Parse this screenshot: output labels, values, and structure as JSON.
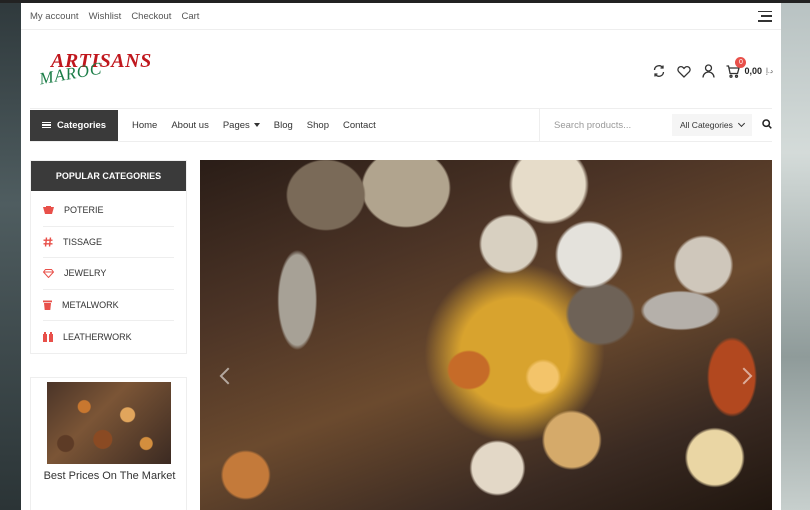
{
  "topbar": {
    "links": [
      "My account",
      "Wishlist",
      "Checkout",
      "Cart"
    ]
  },
  "logo": {
    "line1": "ARTISANS",
    "line2": "MAROC"
  },
  "cart": {
    "count": "0",
    "total": "0,00",
    "currency": "د.إ"
  },
  "nav": {
    "categories_label": "Categories",
    "menu": [
      "Home",
      "About us",
      "Pages",
      "Blog",
      "Shop",
      "Contact"
    ],
    "search_placeholder": "Search products...",
    "category_select": "All Categories"
  },
  "sidebar": {
    "heading": "POPULAR CATEGORIES",
    "items": [
      {
        "label": "POTERIE",
        "icon": "pottery-icon"
      },
      {
        "label": "TISSAGE",
        "icon": "hash-icon"
      },
      {
        "label": "JEWELRY",
        "icon": "diamond-icon"
      },
      {
        "label": "METALWORK",
        "icon": "trash-icon"
      },
      {
        "label": "LEATHERWORK",
        "icon": "leather-icon"
      }
    ]
  },
  "promo": {
    "title": "Best Prices On The Market"
  },
  "colors": {
    "accent": "#e8504a",
    "dark": "#3a3a3a"
  }
}
